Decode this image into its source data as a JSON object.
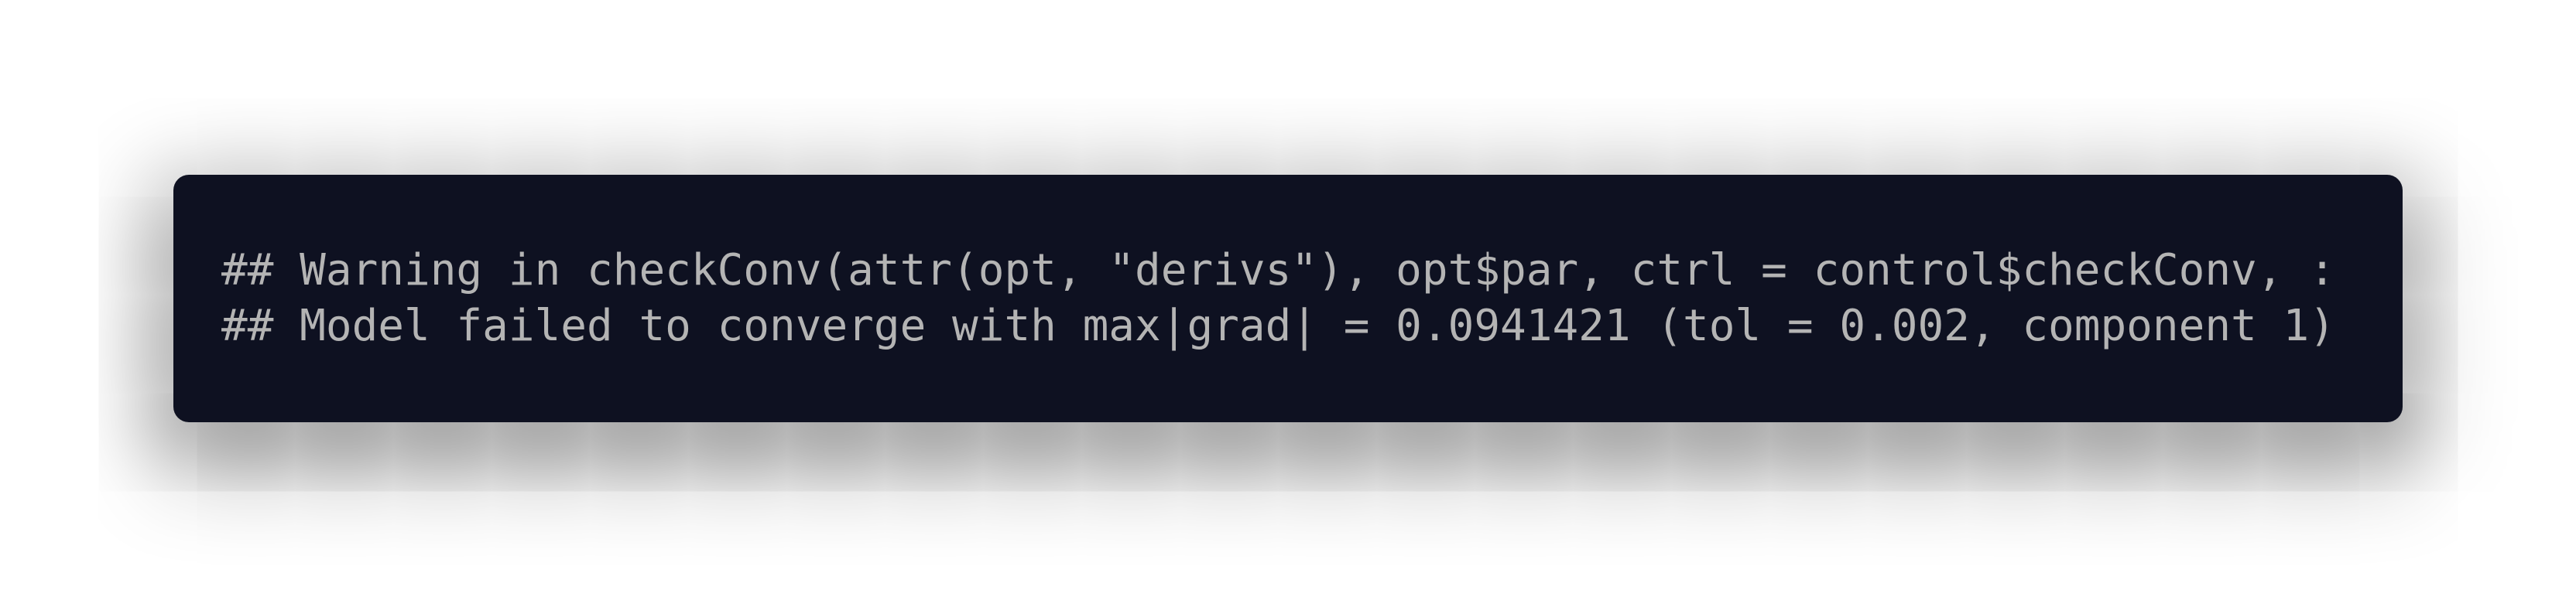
{
  "output": {
    "lines": [
      "## Warning in checkConv(attr(opt, \"derivs\"), opt$par, ctrl = control$checkConv, :",
      "## Model failed to converge with max|grad| = 0.0941421 (tol = 0.002, component 1)"
    ]
  },
  "colors": {
    "background": "#ffffff",
    "code_background": "#0e1121",
    "code_text": "#b4b4b4"
  }
}
